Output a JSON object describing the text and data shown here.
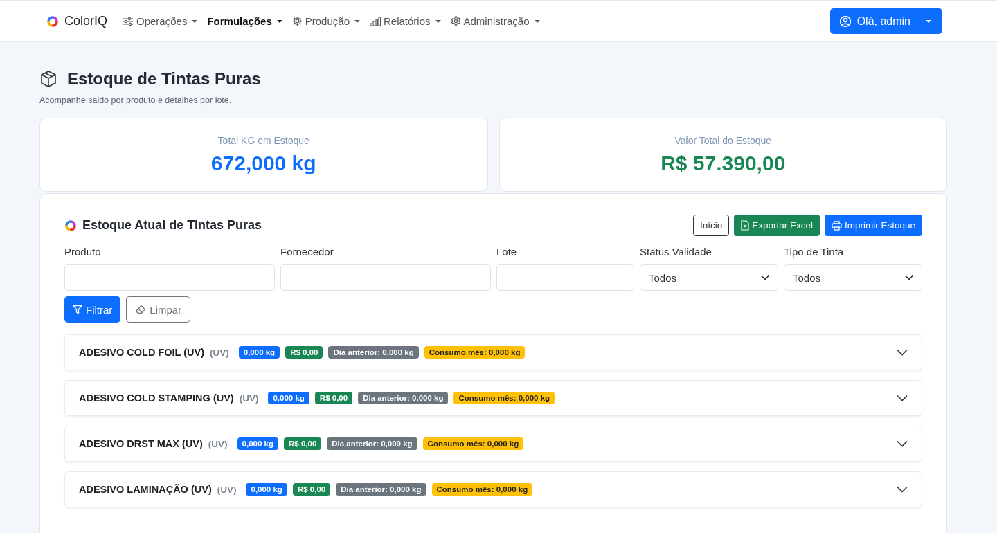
{
  "navbar": {
    "brand": "ColorIQ",
    "menu": [
      {
        "label": "Operações",
        "selected": false
      },
      {
        "label": "Formulações",
        "selected": true
      },
      {
        "label": "Produção",
        "selected": false
      },
      {
        "label": "Relatórios",
        "selected": false
      },
      {
        "label": "Administração",
        "selected": false
      }
    ],
    "user_button": "Olá, admin"
  },
  "header": {
    "title": "Estoque de Tintas Puras",
    "subtitle": "Acompanhe saldo por produto e detalhes por lote."
  },
  "stats": [
    {
      "label": "Total KG em Estoque",
      "value": "672,000 kg",
      "color": "#0d6efd"
    },
    {
      "label": "Valor Total do Estoque",
      "value": "R$ 57.390,00",
      "color": "#198754"
    }
  ],
  "panel": {
    "title": "Estoque Atual de Tintas Puras",
    "actions": [
      {
        "label": "Início",
        "kind": "outline"
      },
      {
        "label": "Exportar Excel",
        "kind": "excel"
      },
      {
        "label": "Imprimir Estoque",
        "kind": "print"
      }
    ],
    "filters": [
      {
        "label": "Produto",
        "kind": "text"
      },
      {
        "label": "Fornecedor",
        "kind": "text"
      },
      {
        "label": "Lote",
        "kind": "text"
      },
      {
        "label": "Status Validade",
        "kind": "select",
        "value": "Todos"
      },
      {
        "label": "Tipo de Tinta",
        "kind": "select",
        "value": "Todos"
      }
    ],
    "filter_button": "Filtrar",
    "clear_button": "Limpar",
    "products": [
      {
        "name": "ADESIVO COLD FOIL (UV)",
        "type": "(UV)",
        "expanded": false,
        "badges": [
          {
            "text": "0,000 kg",
            "color": "#0d6efd"
          },
          {
            "text": "R$ 0,00",
            "color": "#198754"
          },
          {
            "text": "Dia anterior: 0,000 kg",
            "color": "#6c757d"
          },
          {
            "text": "Consumo mês: 0,000 kg",
            "color": "#ffc107"
          }
        ]
      },
      {
        "name": "ADESIVO COLD STAMPING (UV)",
        "type": "(UV)",
        "expanded": false,
        "badges": [
          {
            "text": "0,000 kg",
            "color": "#0d6efd"
          },
          {
            "text": "R$ 0,00",
            "color": "#198754"
          },
          {
            "text": "Dia anterior: 0,000 kg",
            "color": "#6c757d"
          },
          {
            "text": "Consumo mês: 0,000 kg",
            "color": "#ffc107"
          }
        ]
      },
      {
        "name": "ADESIVO DRST MAX (UV)",
        "type": "(UV)",
        "expanded": false,
        "badges": [
          {
            "text": "0,000 kg",
            "color": "#0d6efd"
          },
          {
            "text": "R$ 0,00",
            "color": "#198754"
          },
          {
            "text": "Dia anterior: 0,000 kg",
            "color": "#6c757d"
          },
          {
            "text": "Consumo mês: 0,000 kg",
            "color": "#ffc107"
          }
        ]
      },
      {
        "name": "ADESIVO LAMINAÇÃO (UV)",
        "type": "(UV)",
        "expanded": false,
        "badges": [
          {
            "text": "0,000 kg",
            "color": "#0d6efd"
          },
          {
            "text": "R$ 0,00",
            "color": "#198754"
          },
          {
            "text": "Dia anterior: 0,000 kg",
            "color": "#6c757d"
          },
          {
            "text": "Consumo mês: 0,000 kg",
            "color": "#ffc107"
          }
        ]
      }
    ]
  }
}
